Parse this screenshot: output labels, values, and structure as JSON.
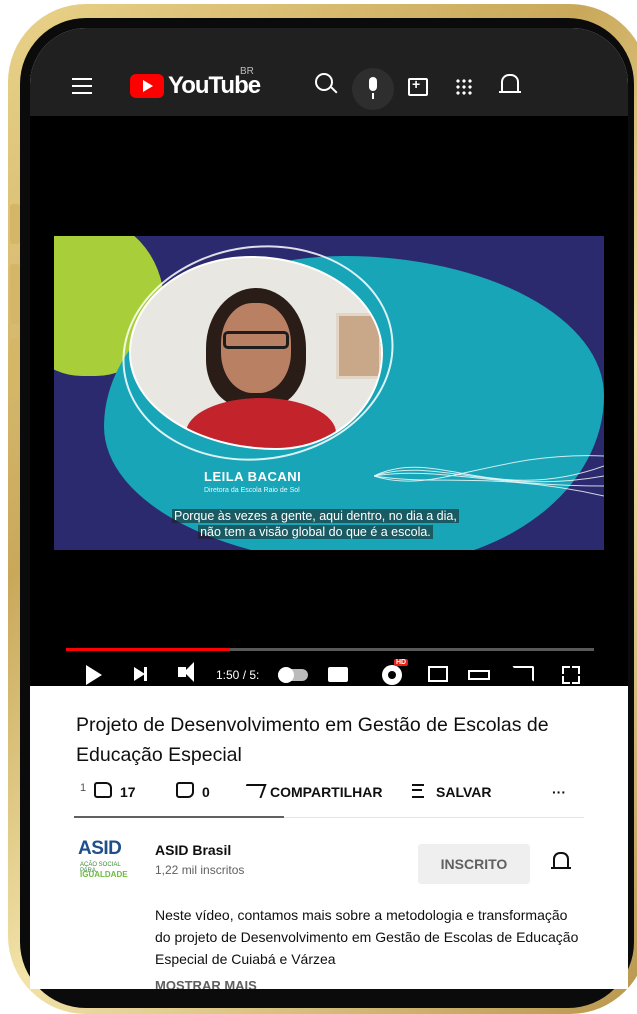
{
  "header": {
    "logo_text": "YouTube",
    "country": "BR",
    "icons": [
      "menu-icon",
      "youtube-logo-icon",
      "search-icon",
      "mic-icon",
      "create-video-icon",
      "apps-icon",
      "notifications-bell-icon"
    ]
  },
  "video": {
    "speaker_name": "LEILA BACANI",
    "speaker_role": "Diretora da Escola Raio de Sol",
    "subtitle_line1": "Porque às vezes a gente, aqui dentro, no dia a dia,",
    "subtitle_line2": "não tem a visão global do que é a escola.",
    "time_display": "1:50 / 5:",
    "progress_fraction": 0.31,
    "hd_badge": "HD"
  },
  "info": {
    "title": "Projeto de Desenvolvimento em Gestão de Escolas de Educação Especial",
    "like_prefix": "1",
    "likes": "17",
    "dislikes": "0",
    "share_label": "COMPARTILHAR",
    "save_label": "SALVAR",
    "more_actions": "···"
  },
  "channel": {
    "logo_text": "ASID",
    "logo_sub": "AÇÃO SOCIAL PARA",
    "logo_igualdade": "IGUALDADE",
    "name": "ASID Brasil",
    "subscribers": "1,22 mil inscritos",
    "subscribe_label": "INSCRITO"
  },
  "description": {
    "text": "Neste vídeo, contamos mais sobre a metodologia e transformação do projeto de Desenvolvimento em Gestão de Escolas de Educação Especial de Cuiabá e Várzea",
    "show_more": "MOSTRAR MAIS"
  },
  "colors": {
    "phone_frame": "#c9a85a",
    "youtube_red": "#ff0000",
    "video_navy": "#2b2a6e",
    "video_teal": "#17a5b7",
    "video_green": "#a8cf3a"
  }
}
